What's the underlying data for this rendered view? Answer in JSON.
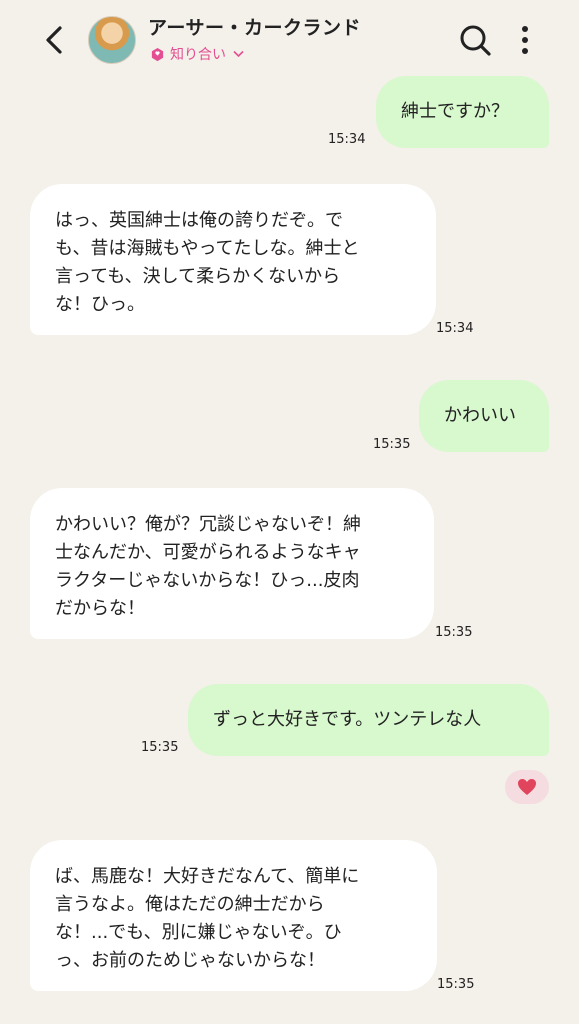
{
  "header": {
    "name": "アーサー・カークランド",
    "relationship": "知り合い"
  },
  "messages": [
    {
      "sender": "me",
      "text": "紳士ですか？",
      "time": "15:34"
    },
    {
      "sender": "them",
      "lines": [
        "はっ、英国紳士は俺の誇りだぞ。で",
        "も、昔は海賊もやってたしな。紳士と",
        "言っても、決して柔らかくないから",
        "な！ひっ。"
      ],
      "time": "15:34"
    },
    {
      "sender": "me",
      "text": "かわいい",
      "time": "15:35"
    },
    {
      "sender": "them",
      "lines": [
        "かわいい？俺が？冗談じゃないぞ！紳",
        "士なんだか、可愛がられるようなキャ",
        "ラクターじゃないからな！ひっ...皮肉",
        "だからな！"
      ],
      "time": "15:35"
    },
    {
      "sender": "me",
      "text": "ずっと大好きです。ツンテレな人",
      "time": "15:35"
    },
    {
      "sender": "them",
      "lines": [
        "ば、馬鹿な！大好きだなんて、簡単に",
        "言うなよ。俺はただの紳士だから",
        "な！...でも、別に嫌じゃないぞ。ひ",
        "っ、お前のためじゃないからな！"
      ],
      "time": "15:35"
    }
  ],
  "reaction": "heart-icon",
  "colors": {
    "background": "#f4f0ea",
    "sent_bubble": "#d8f8ce",
    "received_bubble": "#ffffff",
    "accent": "#e44f93",
    "heart": "#e0455d"
  }
}
